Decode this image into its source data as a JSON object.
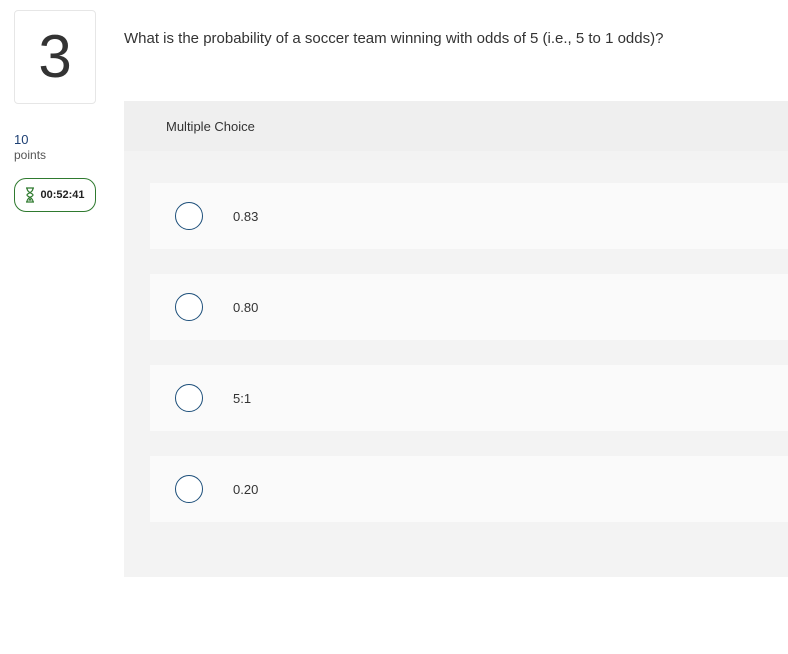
{
  "question": {
    "number": "3",
    "points_value": "10",
    "points_label": "points",
    "timer": "00:52:41",
    "text": "What is the probability of a soccer team winning with odds of 5 (i.e., 5 to 1 odds)?",
    "type_label": "Multiple Choice",
    "options": [
      {
        "label": "0.83"
      },
      {
        "label": "0.80"
      },
      {
        "label": "5:1"
      },
      {
        "label": "0.20"
      }
    ]
  },
  "colors": {
    "accent_blue": "#1d4f7a",
    "timer_border": "#2f7a2f",
    "panel_bg": "#efefef",
    "option_bg": "#fafafa"
  },
  "icons": {
    "timer": "hourglass-icon",
    "option": "radio-button-icon"
  }
}
